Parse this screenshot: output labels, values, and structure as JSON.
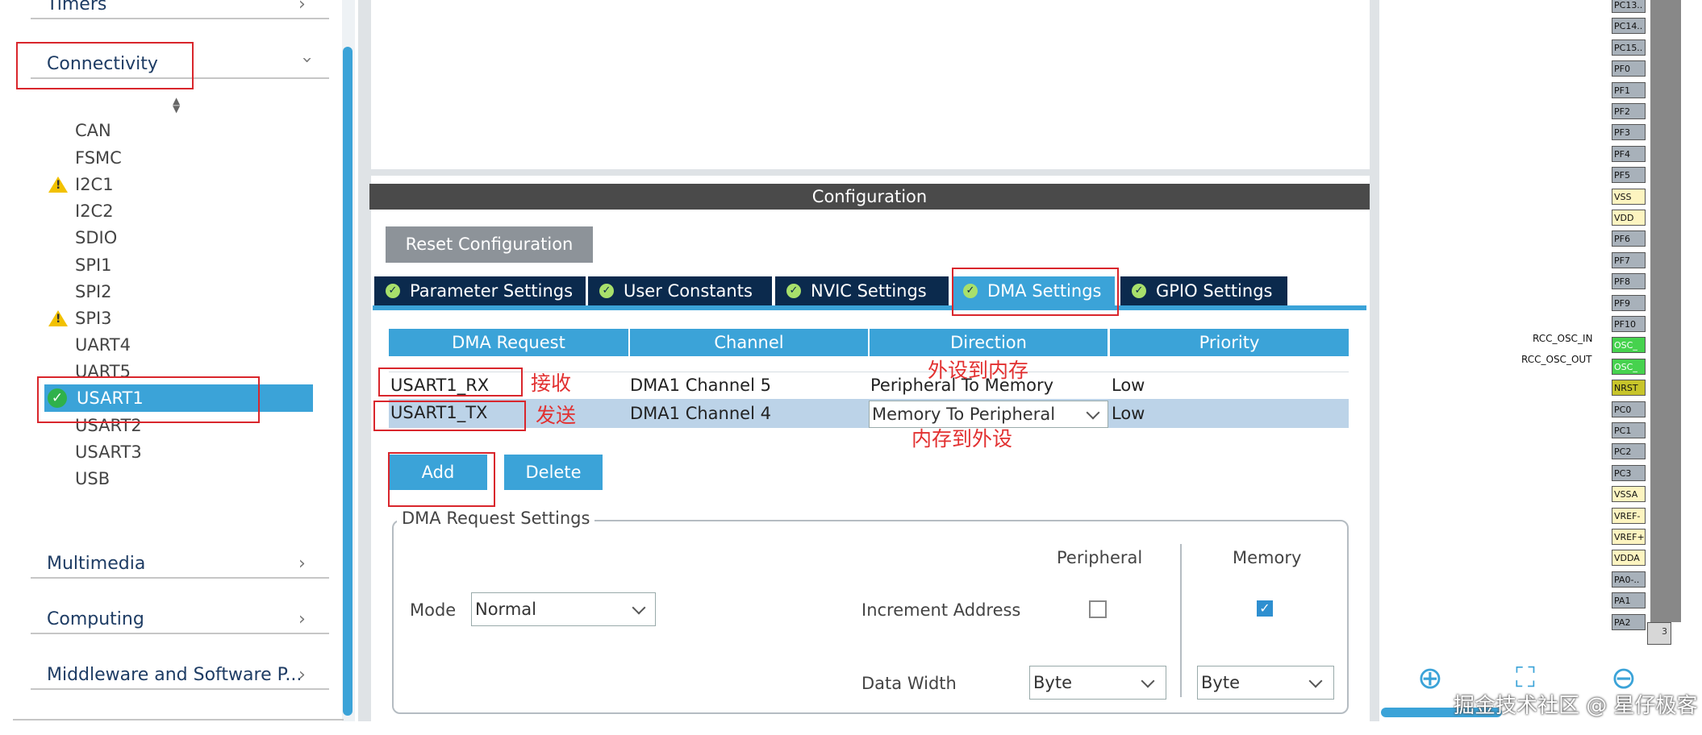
{
  "sidebar": {
    "categories": {
      "timers": "Timers",
      "connectivity": "Connectivity",
      "multimedia": "Multimedia",
      "computing": "Computing",
      "middleware": "Middleware and Software P..."
    },
    "items": [
      "CAN",
      "FSMC",
      "I2C1",
      "I2C2",
      "SDIO",
      "SPI1",
      "SPI2",
      "SPI3",
      "UART4",
      "UART5",
      "USART1",
      "USART2",
      "USART3",
      "USB"
    ]
  },
  "config": {
    "header": "Configuration",
    "reset_button": "Reset Configuration",
    "tabs": [
      "Parameter Settings",
      "User Constants",
      "NVIC Settings",
      "DMA Settings",
      "GPIO Settings"
    ],
    "active_tab": "DMA Settings",
    "table": {
      "headers": [
        "DMA Request",
        "Channel",
        "Direction",
        "Priority"
      ],
      "rows": [
        {
          "request": "USART1_RX",
          "channel": "DMA1 Channel 5",
          "direction": "Peripheral To Memory",
          "priority": "Low"
        },
        {
          "request": "USART1_TX",
          "channel": "DMA1 Channel 4",
          "direction": "Memory To Peripheral",
          "priority": "Low"
        }
      ]
    },
    "add_button": "Add",
    "delete_button": "Delete",
    "request_settings": {
      "legend": "DMA Request Settings",
      "peripheral_header": "Peripheral",
      "memory_header": "Memory",
      "mode_label": "Mode",
      "mode_value": "Normal",
      "increment_label": "Increment Address",
      "peripheral_increment": false,
      "memory_increment": true,
      "data_width_label": "Data Width",
      "peripheral_width": "Byte",
      "memory_width": "Byte"
    }
  },
  "annotations": {
    "rx": "接收",
    "tx": "发送",
    "p2m": "外设到内存",
    "m2p": "内存到外设",
    "color": "#e23030"
  },
  "chip": {
    "pins": [
      "PC13..",
      "PC14..",
      "PC15..",
      "PF0",
      "PF1",
      "PF2",
      "PF3",
      "PF4",
      "PF5",
      "VSS",
      "VDD",
      "PF6",
      "PF7",
      "PF8",
      "PF9",
      "PF10",
      "OSC_",
      "OSC_",
      "NRST",
      "PC0",
      "PC1",
      "PC2",
      "PC3",
      "VSSA",
      "VREF-",
      "VREF+",
      "VDDA",
      "PA0-..",
      "PA1",
      "PA2"
    ],
    "signal_labels": {
      "osc_in": "RCC_OSC_IN",
      "osc_out": "RCC_OSC_OUT"
    },
    "stub_label": "3"
  },
  "watermark": "掘金技术社区 @ 星仔极客",
  "colors": {
    "accent": "#3ba3d8",
    "tab_dark": "#0b2a4d",
    "header": "#4a4a4a",
    "annotation": "#d9262c"
  }
}
